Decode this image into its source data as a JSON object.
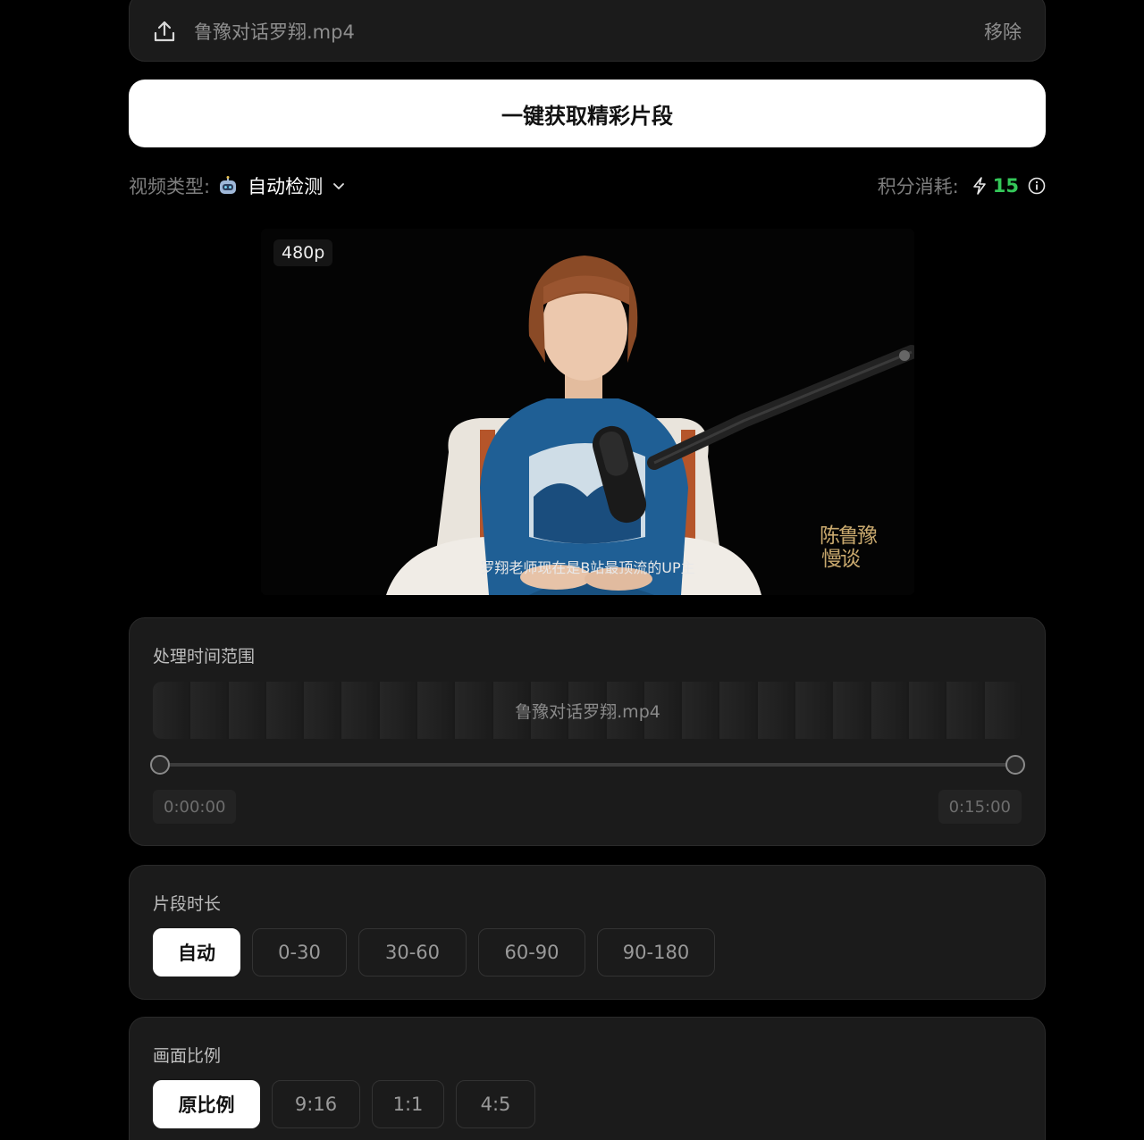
{
  "file": {
    "name": "鲁豫对话罗翔.mp4",
    "remove_label": "移除"
  },
  "main_button_label": "一键获取精彩片段",
  "meta": {
    "video_type_label": "视频类型:",
    "video_type_value": "自动检测",
    "credits_label": "积分消耗:",
    "credits_value": "15",
    "credits_color": "#34c759"
  },
  "video": {
    "resolution": "480p",
    "subtitle": "罗翔老师现在是B站最顶流的UP主",
    "watermark_text": "陈鲁豫慢谈"
  },
  "range": {
    "title": "处理时间范围",
    "filename": "鲁豫对话罗翔.mp4",
    "start": "0:00:00",
    "end": "0:15:00"
  },
  "duration": {
    "title": "片段时长",
    "options": [
      "自动",
      "0-30",
      "30-60",
      "60-90",
      "90-180"
    ],
    "selected": "自动"
  },
  "ratio": {
    "title": "画面比例",
    "options": [
      "原比例",
      "9:16",
      "1:1",
      "4:5"
    ],
    "selected": "原比例"
  }
}
